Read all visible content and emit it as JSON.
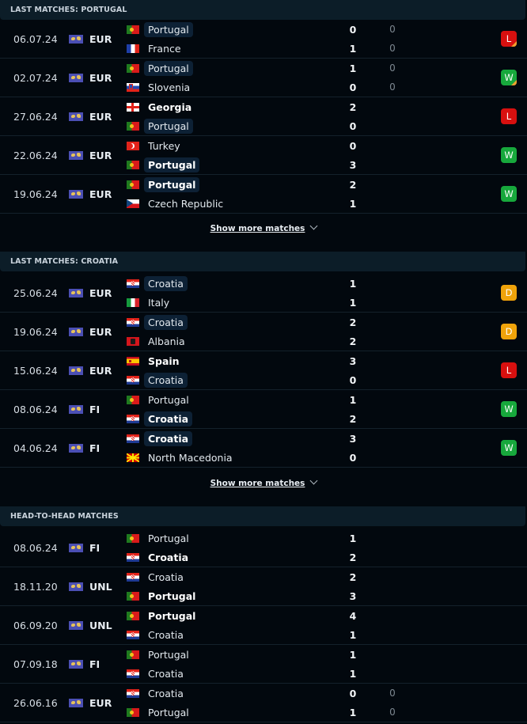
{
  "colors": {
    "win": "#17a83c",
    "loss": "#d8100f",
    "draw": "#f0a30a",
    "penalty_corner": "#f0a030",
    "highlight_chip": "#0d2135",
    "header_bg": "#0c1d28",
    "page_bg": "#02080e"
  },
  "sections": [
    {
      "title": "LAST MATCHES: PORTUGAL",
      "show_more_label": "Show more matches",
      "matches": [
        {
          "date": "06.07.24",
          "league": "EUR",
          "league_icon": "world-map-icon",
          "home": {
            "name": "Portugal",
            "flag": "portugal",
            "score": "0",
            "ht": "0",
            "highlight": true,
            "win": false
          },
          "away": {
            "name": "France",
            "flag": "france",
            "score": "1",
            "ht": "0",
            "highlight": false,
            "win": false
          },
          "result": "L",
          "penalties": true
        },
        {
          "date": "02.07.24",
          "league": "EUR",
          "league_icon": "world-map-icon",
          "home": {
            "name": "Portugal",
            "flag": "portugal",
            "score": "1",
            "ht": "0",
            "highlight": true,
            "win": false
          },
          "away": {
            "name": "Slovenia",
            "flag": "slovenia",
            "score": "0",
            "ht": "0",
            "highlight": false,
            "win": false
          },
          "result": "W",
          "penalties": true
        },
        {
          "date": "27.06.24",
          "league": "EUR",
          "league_icon": "world-map-icon",
          "home": {
            "name": "Georgia",
            "flag": "georgia",
            "score": "2",
            "ht": null,
            "highlight": false,
            "win": true
          },
          "away": {
            "name": "Portugal",
            "flag": "portugal",
            "score": "0",
            "ht": null,
            "highlight": true,
            "win": false
          },
          "result": "L",
          "penalties": false
        },
        {
          "date": "22.06.24",
          "league": "EUR",
          "league_icon": "world-map-icon",
          "home": {
            "name": "Turkey",
            "flag": "turkey",
            "score": "0",
            "ht": null,
            "highlight": false,
            "win": false
          },
          "away": {
            "name": "Portugal",
            "flag": "portugal",
            "score": "3",
            "ht": null,
            "highlight": true,
            "win": true
          },
          "result": "W",
          "penalties": false
        },
        {
          "date": "19.06.24",
          "league": "EUR",
          "league_icon": "world-map-icon",
          "home": {
            "name": "Portugal",
            "flag": "portugal",
            "score": "2",
            "ht": null,
            "highlight": true,
            "win": true
          },
          "away": {
            "name": "Czech Republic",
            "flag": "czech",
            "score": "1",
            "ht": null,
            "highlight": false,
            "win": false
          },
          "result": "W",
          "penalties": false
        }
      ]
    },
    {
      "title": "LAST MATCHES: CROATIA",
      "show_more_label": "Show more matches",
      "matches": [
        {
          "date": "25.06.24",
          "league": "EUR",
          "league_icon": "world-map-icon",
          "home": {
            "name": "Croatia",
            "flag": "croatia",
            "score": "1",
            "ht": null,
            "highlight": true,
            "win": false
          },
          "away": {
            "name": "Italy",
            "flag": "italy",
            "score": "1",
            "ht": null,
            "highlight": false,
            "win": false
          },
          "result": "D",
          "penalties": false
        },
        {
          "date": "19.06.24",
          "league": "EUR",
          "league_icon": "world-map-icon",
          "home": {
            "name": "Croatia",
            "flag": "croatia",
            "score": "2",
            "ht": null,
            "highlight": true,
            "win": false
          },
          "away": {
            "name": "Albania",
            "flag": "albania",
            "score": "2",
            "ht": null,
            "highlight": false,
            "win": false
          },
          "result": "D",
          "penalties": false
        },
        {
          "date": "15.06.24",
          "league": "EUR",
          "league_icon": "world-map-icon",
          "home": {
            "name": "Spain",
            "flag": "spain",
            "score": "3",
            "ht": null,
            "highlight": false,
            "win": true
          },
          "away": {
            "name": "Croatia",
            "flag": "croatia",
            "score": "0",
            "ht": null,
            "highlight": true,
            "win": false
          },
          "result": "L",
          "penalties": false
        },
        {
          "date": "08.06.24",
          "league": "FI",
          "league_icon": "world-map-icon",
          "home": {
            "name": "Portugal",
            "flag": "portugal",
            "score": "1",
            "ht": null,
            "highlight": false,
            "win": false
          },
          "away": {
            "name": "Croatia",
            "flag": "croatia",
            "score": "2",
            "ht": null,
            "highlight": true,
            "win": true
          },
          "result": "W",
          "penalties": false
        },
        {
          "date": "04.06.24",
          "league": "FI",
          "league_icon": "world-map-icon",
          "home": {
            "name": "Croatia",
            "flag": "croatia",
            "score": "3",
            "ht": null,
            "highlight": true,
            "win": true
          },
          "away": {
            "name": "North Macedonia",
            "flag": "north-macedonia",
            "score": "0",
            "ht": null,
            "highlight": false,
            "win": false
          },
          "result": "W",
          "penalties": false
        }
      ]
    },
    {
      "title": "HEAD-TO-HEAD MATCHES",
      "show_more_label": null,
      "matches": [
        {
          "date": "08.06.24",
          "league": "FI",
          "league_icon": "world-map-icon",
          "home": {
            "name": "Portugal",
            "flag": "portugal",
            "score": "1",
            "ht": null,
            "highlight": false,
            "win": false
          },
          "away": {
            "name": "Croatia",
            "flag": "croatia",
            "score": "2",
            "ht": null,
            "highlight": false,
            "win": true
          },
          "result": null,
          "penalties": false
        },
        {
          "date": "18.11.20",
          "league": "UNL",
          "league_icon": "world-map-icon",
          "home": {
            "name": "Croatia",
            "flag": "croatia",
            "score": "2",
            "ht": null,
            "highlight": false,
            "win": false
          },
          "away": {
            "name": "Portugal",
            "flag": "portugal",
            "score": "3",
            "ht": null,
            "highlight": false,
            "win": true
          },
          "result": null,
          "penalties": false
        },
        {
          "date": "06.09.20",
          "league": "UNL",
          "league_icon": "world-map-icon",
          "home": {
            "name": "Portugal",
            "flag": "portugal",
            "score": "4",
            "ht": null,
            "highlight": false,
            "win": true
          },
          "away": {
            "name": "Croatia",
            "flag": "croatia",
            "score": "1",
            "ht": null,
            "highlight": false,
            "win": false
          },
          "result": null,
          "penalties": false
        },
        {
          "date": "07.09.18",
          "league": "FI",
          "league_icon": "world-map-icon",
          "home": {
            "name": "Portugal",
            "flag": "portugal",
            "score": "1",
            "ht": null,
            "highlight": false,
            "win": false
          },
          "away": {
            "name": "Croatia",
            "flag": "croatia",
            "score": "1",
            "ht": null,
            "highlight": false,
            "win": false
          },
          "result": null,
          "penalties": false
        },
        {
          "date": "26.06.16",
          "league": "EUR",
          "league_icon": "world-map-icon",
          "home": {
            "name": "Croatia",
            "flag": "croatia",
            "score": "0",
            "ht": "0",
            "highlight": false,
            "win": false
          },
          "away": {
            "name": "Portugal",
            "flag": "portugal",
            "score": "1",
            "ht": "0",
            "highlight": false,
            "win": false
          },
          "result": null,
          "penalties": false
        }
      ]
    }
  ]
}
